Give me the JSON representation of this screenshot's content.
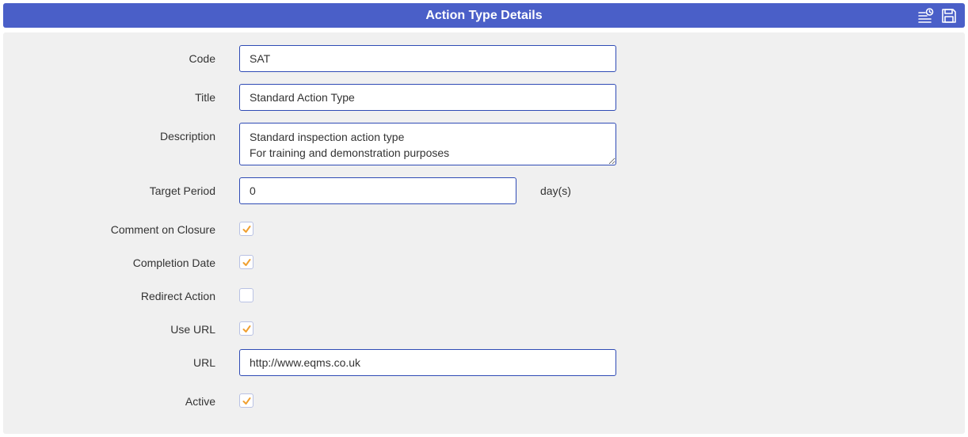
{
  "header": {
    "title": "Action Type Details",
    "icons": [
      "history-list-icon",
      "save-icon"
    ],
    "color": "#4a5fc8"
  },
  "form": {
    "code": {
      "label": "Code",
      "value": "SAT"
    },
    "title": {
      "label": "Title",
      "value": "Standard Action Type"
    },
    "description": {
      "label": "Description",
      "value": "Standard inspection action type\nFor training and demonstration purposes"
    },
    "target_period": {
      "label": "Target Period",
      "value": "0",
      "unit": "day(s)"
    },
    "comment_on_closure": {
      "label": "Comment on Closure",
      "checked": true
    },
    "completion_date": {
      "label": "Completion Date",
      "checked": true
    },
    "redirect_action": {
      "label": "Redirect Action",
      "checked": false
    },
    "use_url": {
      "label": "Use URL",
      "checked": true
    },
    "url": {
      "label": "URL",
      "value": "http://www.eqms.co.uk"
    },
    "active": {
      "label": "Active",
      "checked": true
    }
  },
  "colors": {
    "field_border": "#2f4bb5",
    "check_mark": "#f0a030",
    "panel_bg": "#f0f0f0"
  }
}
